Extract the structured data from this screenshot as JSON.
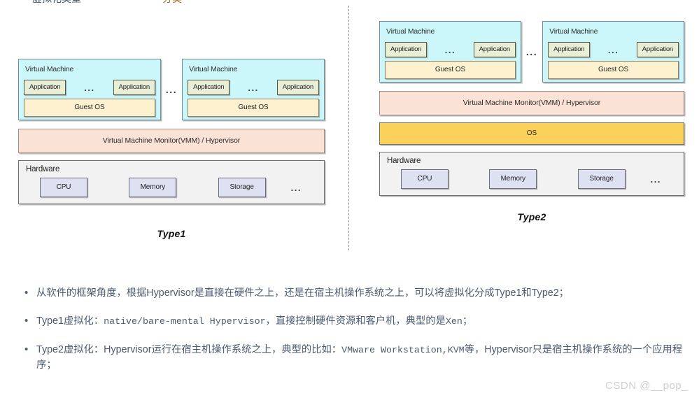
{
  "diagram": {
    "divider": "vertical-dashed-separator",
    "ellipsis": "...",
    "panels": [
      {
        "id": "type1",
        "caption": "Type1",
        "vms": [
          {
            "title": "Virtual Machine",
            "apps": [
              "Application",
              "Application"
            ],
            "app_ellipsis": "...",
            "guest_os": "Guest OS"
          },
          {
            "title": "Virtual Machine",
            "apps": [
              "Application",
              "Application"
            ],
            "app_ellipsis": "...",
            "guest_os": "Guest OS"
          }
        ],
        "vmm": "Virtual Machine Monitor(VMM) / Hypervisor",
        "os": null,
        "hardware": {
          "title": "Hardware",
          "items": [
            "CPU",
            "Memory",
            "Storage"
          ],
          "ellipsis": "..."
        }
      },
      {
        "id": "type2",
        "caption": "Type2",
        "vms": [
          {
            "title": "Virtual Machine",
            "apps": [
              "Application",
              "Application"
            ],
            "app_ellipsis": "...",
            "guest_os": "Guest OS"
          },
          {
            "title": "Virtual Machine",
            "apps": [
              "Application",
              "Application"
            ],
            "app_ellipsis": "...",
            "guest_os": "Guest OS"
          }
        ],
        "vmm": "Virtual Machine Monitor(VMM) / Hypervisor",
        "os": "OS",
        "hardware": {
          "title": "Hardware",
          "items": [
            "CPU",
            "Memory",
            "Storage"
          ],
          "ellipsis": "..."
        }
      }
    ]
  },
  "bullets": [
    {
      "parts": [
        {
          "text": "从软件的框架角度，根据Hypervisor是直接在硬件之上，还是在宿主机操作系统之上，可以将虚拟化分成Type1和Type2；",
          "mono": false
        }
      ]
    },
    {
      "parts": [
        {
          "text": "Type1虚拟化：",
          "mono": false
        },
        {
          "text": "native/bare-mental Hypervisor",
          "mono": true
        },
        {
          "text": "，直接控制硬件资源和客户机，典型的是",
          "mono": false
        },
        {
          "text": "Xen",
          "mono": true
        },
        {
          "text": "；",
          "mono": false
        }
      ]
    },
    {
      "parts": [
        {
          "text": "Type2虚拟化：Hypervisor运行在宿主机操作系统之上，典型的比如：",
          "mono": false
        },
        {
          "text": "VMware Workstation,KVM",
          "mono": true
        },
        {
          "text": "等，Hypervisor只是宿主机操作系统的一个应用程序；",
          "mono": false
        }
      ]
    }
  ],
  "watermark": "CSDN @__pop_",
  "colors": {
    "vm_fill": "#ccf7fa",
    "app_fill": "#e9eed6",
    "guest_os_fill": "#fdf1cf",
    "vmm_fill": "#fae3d6",
    "os_fill": "#fbd15c",
    "hardware_fill": "#f2f2f2",
    "hw_item_fill": "#dde1f1",
    "bullet_text": "#4a5a70",
    "watermark": "#cfcfcf"
  }
}
